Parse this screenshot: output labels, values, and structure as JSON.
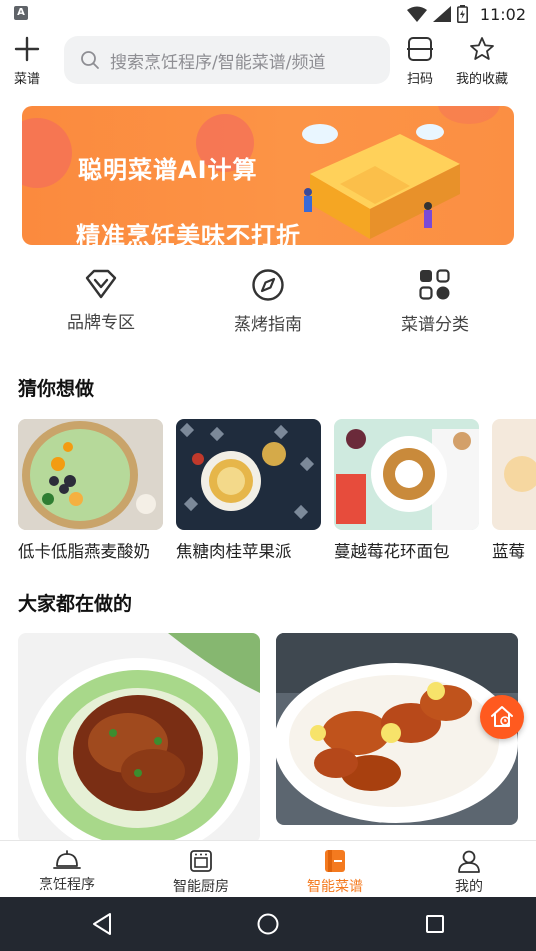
{
  "status_bar": {
    "time": "11:02",
    "notification_icon": "a-box-icon"
  },
  "header": {
    "menu_label": "菜谱",
    "search_placeholder": "搜索烹饪程序/智能菜谱/频道",
    "scan_label": "扫码",
    "favorites_label": "我的收藏"
  },
  "banner": {
    "line1": "聪明菜谱AI计算",
    "line2": "精准烹饪美味不打折",
    "colors": {
      "background": "#fc9446",
      "circle": "#f46f5a"
    }
  },
  "quick_entries": [
    {
      "label": "品牌专区",
      "icon": "diamond-icon"
    },
    {
      "label": "蒸烤指南",
      "icon": "compass-icon"
    },
    {
      "label": "菜谱分类",
      "icon": "grid-icon"
    }
  ],
  "guess_section": {
    "title": "猜你想做",
    "items": [
      {
        "name": "低卡低脂燕麦酸奶"
      },
      {
        "name": "焦糖肉桂苹果派"
      },
      {
        "name": "蔓越莓花环面包"
      },
      {
        "name": "蓝莓"
      }
    ]
  },
  "popular_section": {
    "title": "大家都在做的"
  },
  "tab_bar": {
    "tabs": [
      {
        "label": "烹饪程序",
        "icon": "cloche-icon",
        "active": false
      },
      {
        "label": "智能厨房",
        "icon": "oven-icon",
        "active": false
      },
      {
        "label": "智能菜谱",
        "icon": "recipe-book-icon",
        "active": true
      },
      {
        "label": "我的",
        "icon": "person-icon",
        "active": false
      }
    ],
    "active_color": "#f47a1f"
  }
}
